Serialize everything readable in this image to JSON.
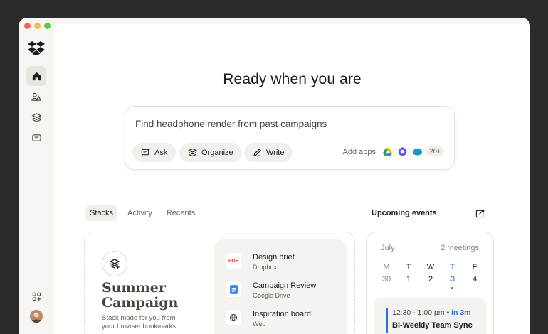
{
  "colors": {
    "background": "#2b2b2b",
    "window": "#f7f5f2",
    "accent_blue": "#2a6fdb",
    "traffic_red": "#ec6a5e",
    "traffic_yellow": "#f4bf4f",
    "traffic_green": "#61c554"
  },
  "sidebar": {
    "items": [
      {
        "icon": "home-icon",
        "active": true
      },
      {
        "icon": "people-icon",
        "active": false
      },
      {
        "icon": "layers-icon",
        "active": false
      },
      {
        "icon": "chat-icon",
        "active": false
      }
    ],
    "bottom": [
      {
        "icon": "apps-grid-icon"
      },
      {
        "icon": "avatar"
      }
    ]
  },
  "hero": {
    "title": "Ready when you are"
  },
  "search": {
    "text": "Find headphone render from past campaigns",
    "chips": [
      {
        "label": "Ask",
        "icon": "ask-icon"
      },
      {
        "label": "Organize",
        "icon": "organize-icon"
      },
      {
        "label": "Write",
        "icon": "write-icon"
      }
    ],
    "add_apps_label": "Add apps",
    "apps": [
      "google-drive-icon",
      "hexagon-app-icon",
      "salesforce-icon"
    ],
    "apps_more": "20+"
  },
  "tabs": [
    {
      "label": "Stacks",
      "active": true
    },
    {
      "label": "Activity",
      "active": false
    },
    {
      "label": "Recents",
      "active": false
    }
  ],
  "stack": {
    "title_line1": "Summer",
    "title_line2": "Campaign",
    "description": "Stack made for you from your browser bookmarks.",
    "links": [
      {
        "icon_label": "PDF",
        "title": "Design brief",
        "source": "Dropbox"
      },
      {
        "icon_label": "",
        "title": "Campaign Review",
        "source": "Google Drive"
      },
      {
        "icon_label": "",
        "title": "Inspiration board",
        "source": "Web"
      }
    ]
  },
  "calendar": {
    "heading": "Upcoming events",
    "month": "July",
    "meetings": "2 meetings",
    "weekdays": [
      "M",
      "T",
      "W",
      "T",
      "F"
    ],
    "dates": [
      "30",
      "1",
      "2",
      "3",
      "4"
    ],
    "today_index": 3,
    "event": {
      "time": "12:30 - 1:00 pm",
      "separator": "•",
      "relative": "in 3m",
      "title": "Bi-Weekly Team Sync"
    }
  }
}
